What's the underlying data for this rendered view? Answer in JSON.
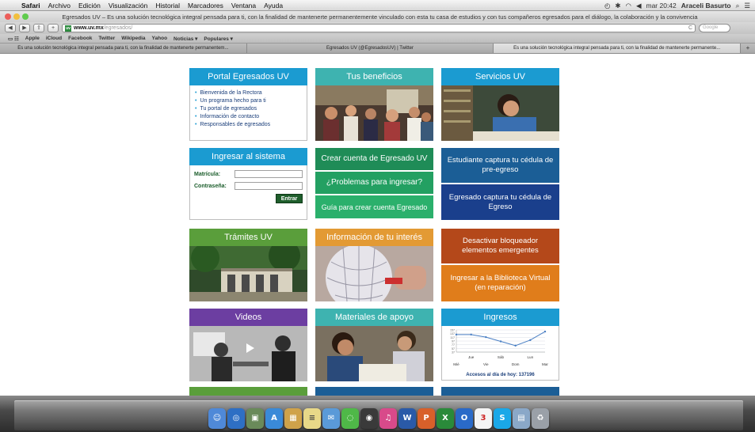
{
  "menubar": {
    "apple": "",
    "app": "Safari",
    "items": [
      "Archivo",
      "Edición",
      "Visualización",
      "Historial",
      "Marcadores",
      "Ventana",
      "Ayuda"
    ],
    "clock": "mar 20:42",
    "user": "Araceli Basurto"
  },
  "window": {
    "title": "Egresados UV – Es una solución tecnológica integral pensada para ti, con la finalidad de mantenerte permanentemente vinculado con esta tu casa de estudios y con tus compañeros egresados para el diálogo, la colaboración y la convivencia"
  },
  "toolbar": {
    "back": "◀",
    "forward": "▶",
    "share": "⇪",
    "add": "+",
    "domain": "www.uv.mx",
    "path": "/egresados/",
    "reload": "C",
    "search_placeholder": "Google"
  },
  "bookmarks": [
    "Apple",
    "iCloud",
    "Facebook",
    "Twitter",
    "Wikipedia",
    "Yahoo",
    "Noticias ▾",
    "Populares ▾"
  ],
  "tabs": [
    {
      "label": "Es una solución tecnológica integral pensada para ti, con la finalidad de mantenerte permanentem..."
    },
    {
      "label": "Egresados UV (@EgresadosUV) | Twitter"
    },
    {
      "label": "Es una solución tecnológica integral pensada para ti, con la finalidad de mantenerte permanente..."
    }
  ],
  "portal": {
    "title": "Portal Egresados UV",
    "links": [
      "Bienvenida de la Rectora",
      "Un programa hecho para ti",
      "Tu portal de egresados",
      "Información de contacto",
      "Responsables de egresados"
    ]
  },
  "beneficios": {
    "title": "Tus beneficios"
  },
  "servicios": {
    "title": "Servicios UV"
  },
  "login": {
    "title": "Ingresar al sistema",
    "matricula_label": "Matrícula:",
    "contrasena_label": "Contraseña:",
    "button": "Entrar"
  },
  "cuenta": {
    "crear": "Crear cuenta de Egresado UV",
    "problemas": "¿Problemas para ingresar?",
    "guia": "Guía para crear cuenta Egresado"
  },
  "cedula": {
    "preegreso": "Estudiante captura tu cédula de pre-egreso",
    "egreso": "Egresado captura tu cédula de Egreso"
  },
  "tramites": {
    "title": "Trámites UV"
  },
  "informacion": {
    "title": "Información de tu interés"
  },
  "bloqueador": {
    "desactivar": "Desactivar bloqueador elementos emergentes",
    "biblioteca": "Ingresar a la Biblioteca Virtual (en reparación)"
  },
  "videos": {
    "title": "Videos"
  },
  "materiales": {
    "title": "Materiales de apoyo"
  },
  "ingresos": {
    "title": "Ingresos",
    "caption": "Accesos al día de hoy: 137196"
  },
  "chart_data": {
    "type": "line",
    "title": "",
    "categories": [
      "Mié",
      "Jue",
      "Vie",
      "Sáb",
      "Dom",
      "Lun",
      "Mar"
    ],
    "tick_row_top": [
      "Jue",
      "Sáb",
      "Lun"
    ],
    "tick_row_bottom": [
      "Mié",
      "Vie",
      "Dom",
      "Mar"
    ],
    "y_ticks": [
      37,
      57,
      77,
      97,
      117,
      137,
      157
    ],
    "values": [
      132,
      132,
      118,
      95,
      72,
      102,
      148
    ],
    "ylim": [
      37,
      157
    ],
    "grid": true,
    "color": "#4a7fc4"
  },
  "dock": {
    "icons": [
      "Finder",
      "Safari",
      "Preview",
      "App Store",
      "Photos",
      "Notes",
      "Mail",
      "Messages",
      "FaceTime",
      "iTunes",
      "Word",
      "PowerPoint",
      "Excel",
      "Outlook",
      "Calendar",
      "Skype",
      "Stacks",
      "Trash"
    ],
    "calendar_day": "3"
  }
}
